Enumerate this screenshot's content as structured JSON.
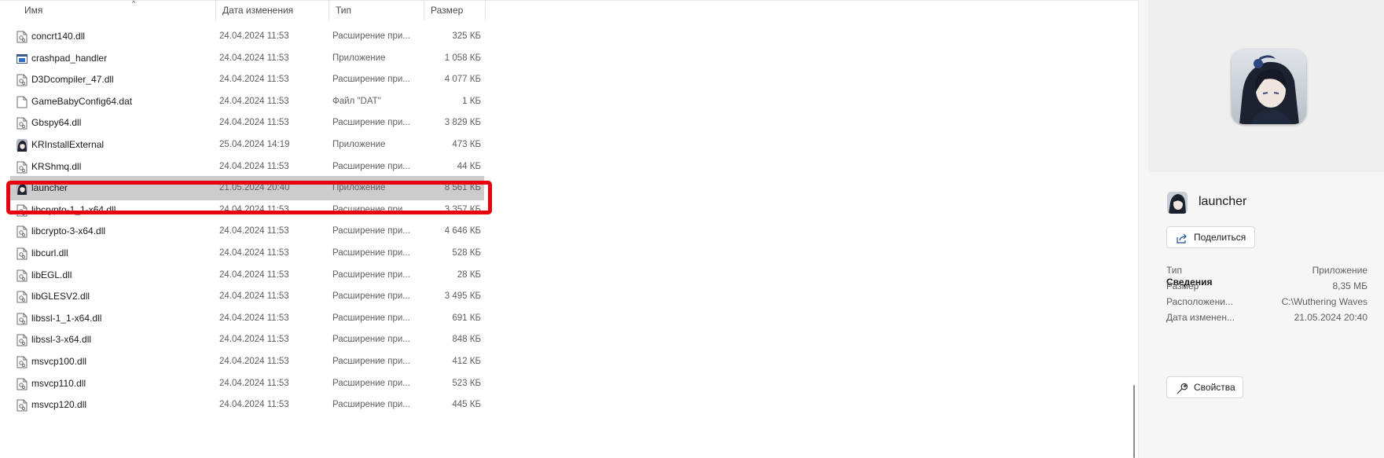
{
  "columns": {
    "name": "Имя",
    "date": "Дата изменения",
    "type": "Тип",
    "size": "Размер"
  },
  "sort_indicator": "^",
  "files": [
    {
      "name": "concrt140.dll",
      "date": "24.04.2024 11:53",
      "type": "Расширение при...",
      "size": "325 КБ",
      "icon": "dll-icon"
    },
    {
      "name": "crashpad_handler",
      "date": "24.04.2024 11:53",
      "type": "Приложение",
      "size": "1 058 КБ",
      "icon": "app-icon"
    },
    {
      "name": "D3Dcompiler_47.dll",
      "date": "24.04.2024 11:53",
      "type": "Расширение при...",
      "size": "4 077 КБ",
      "icon": "dll-icon"
    },
    {
      "name": "GameBabyConfig64.dat",
      "date": "24.04.2024 11:53",
      "type": "Файл \"DAT\"",
      "size": "1 КБ",
      "icon": "file-icon"
    },
    {
      "name": "Gbspy64.dll",
      "date": "24.04.2024 11:53",
      "type": "Расширение при...",
      "size": "3 829 КБ",
      "icon": "dll-icon"
    },
    {
      "name": "KRInstallExternal",
      "date": "25.04.2024 14:19",
      "type": "Приложение",
      "size": "473 КБ",
      "icon": "game-icon"
    },
    {
      "name": "KRShmq.dll",
      "date": "24.04.2024 11:53",
      "type": "Расширение при...",
      "size": "44 КБ",
      "icon": "dll-icon"
    },
    {
      "name": "launcher",
      "date": "21.05.2024 20:40",
      "type": "Приложение",
      "size": "8 561 КБ",
      "icon": "game-icon",
      "selected": true
    },
    {
      "name": "libcrypto-1_1-x64.dll",
      "date": "24.04.2024 11:53",
      "type": "Расширение при...",
      "size": "3 357 КБ",
      "icon": "dll-icon"
    },
    {
      "name": "libcrypto-3-x64.dll",
      "date": "24.04.2024 11:53",
      "type": "Расширение при...",
      "size": "4 646 КБ",
      "icon": "dll-icon"
    },
    {
      "name": "libcurl.dll",
      "date": "24.04.2024 11:53",
      "type": "Расширение при...",
      "size": "528 КБ",
      "icon": "dll-icon"
    },
    {
      "name": "libEGL.dll",
      "date": "24.04.2024 11:53",
      "type": "Расширение при...",
      "size": "28 КБ",
      "icon": "dll-icon"
    },
    {
      "name": "libGLESV2.dll",
      "date": "24.04.2024 11:53",
      "type": "Расширение при...",
      "size": "3 495 КБ",
      "icon": "dll-icon"
    },
    {
      "name": "libssl-1_1-x64.dll",
      "date": "24.04.2024 11:53",
      "type": "Расширение при...",
      "size": "691 КБ",
      "icon": "dll-icon"
    },
    {
      "name": "libssl-3-x64.dll",
      "date": "24.04.2024 11:53",
      "type": "Расширение при...",
      "size": "848 КБ",
      "icon": "dll-icon"
    },
    {
      "name": "msvcp100.dll",
      "date": "24.04.2024 11:53",
      "type": "Расширение при...",
      "size": "412 КБ",
      "icon": "dll-icon"
    },
    {
      "name": "msvcp110.dll",
      "date": "24.04.2024 11:53",
      "type": "Расширение при...",
      "size": "523 КБ",
      "icon": "dll-icon"
    },
    {
      "name": "msvcp120.dll",
      "date": "24.04.2024 11:53",
      "type": "Расширение при...",
      "size": "445 КБ",
      "icon": "dll-icon"
    }
  ],
  "details": {
    "title": "launcher",
    "share_label": "Поделиться",
    "section_label": "Сведения",
    "props_label": "Свойства",
    "fields": [
      {
        "key": "Тип",
        "value": "Приложение"
      },
      {
        "key": "Размер",
        "value": "8,35 МБ"
      },
      {
        "key": "Расположени...",
        "value": "C:\\Wuthering Waves"
      },
      {
        "key": "Дата изменен...",
        "value": "21.05.2024 20:40"
      }
    ]
  },
  "colors": {
    "highlight": "#e8000c",
    "selection": "#cccccc",
    "panel_bg": "#f6f6f6"
  }
}
